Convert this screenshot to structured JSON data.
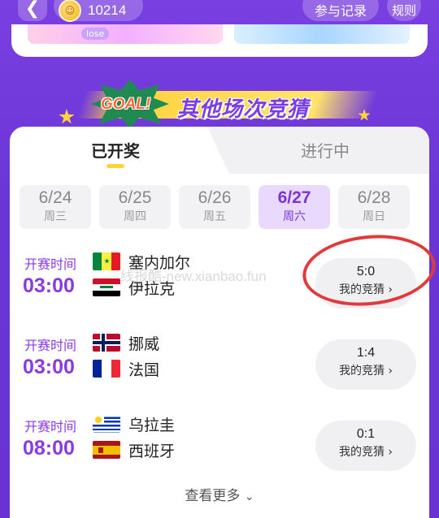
{
  "header": {
    "back_icon": "chevron-left-icon",
    "coin_icon": "coin-icon",
    "coin_balance": "10214",
    "record_label": "参与记录",
    "rules_label": "规则"
  },
  "prev_section": {
    "lose_tag": "lose"
  },
  "banner": {
    "goal_text": "GOAL!",
    "title": "其他场次竞猜"
  },
  "tabs": [
    {
      "label": "已开奖",
      "active": true
    },
    {
      "label": "进行中",
      "active": false
    }
  ],
  "dates": [
    {
      "date": "6/24",
      "weekday": "周三"
    },
    {
      "date": "6/25",
      "weekday": "周四"
    },
    {
      "date": "6/26",
      "weekday": "周五"
    },
    {
      "date": "6/27",
      "weekday": "周六",
      "active": true
    },
    {
      "date": "6/28",
      "weekday": "周日"
    }
  ],
  "matches": [
    {
      "kick_label": "开赛时间",
      "time": "03:00",
      "home": {
        "name": "塞内加尔",
        "flag": "senegal-flag"
      },
      "away": {
        "name": "伊拉克",
        "flag": "iraq-flag"
      },
      "guess": {
        "score": "5:0",
        "label": "我的竞猜"
      }
    },
    {
      "kick_label": "开赛时间",
      "time": "03:00",
      "home": {
        "name": "挪威",
        "flag": "norway-flag"
      },
      "away": {
        "name": "法国",
        "flag": "france-flag"
      },
      "guess": {
        "score": "1:4",
        "label": "我的竞猜"
      }
    },
    {
      "kick_label": "开赛时间",
      "time": "08:00",
      "home": {
        "name": "乌拉圭",
        "flag": "uruguay-flag"
      },
      "away": {
        "name": "西班牙",
        "flag": "spain-flag"
      },
      "guess": {
        "score": "0:1",
        "label": "我的竞猜"
      }
    }
  ],
  "see_more": "查看更多",
  "watermark": "线报酷-new.xianbao.fun",
  "colors": {
    "accent": "#8a3be0",
    "background": "#6b35d6",
    "highlight": "#ffd23d",
    "annotation": "#e23a3a"
  }
}
